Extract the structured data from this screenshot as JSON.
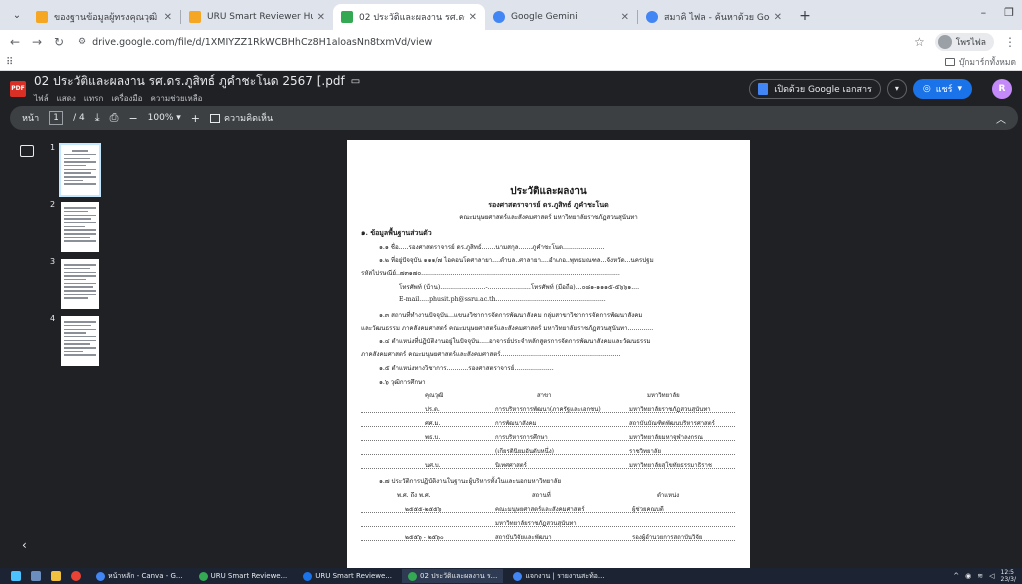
{
  "browser": {
    "tabs": [
      {
        "title": "ของฐานข้อมูลผู้ทรงคุณวุฒิ รายงาน",
        "color": "#f5a623",
        "active": false
      },
      {
        "title": "URU Smart Reviewer Hub",
        "color": "#f5a623",
        "active": false
      },
      {
        "title": "02 ประวัติและผลงาน รศ.ดร.ภูสิทธ์ ภู...",
        "color": "#34a853",
        "active": true
      },
      {
        "title": "Google Gemini",
        "color": "#4285f4",
        "active": false
      },
      {
        "title": "สมาคิ ไฟล - ค้นหาด้วย Google",
        "color": "#4285f4",
        "active": false
      }
    ],
    "url": "drive.google.com/file/d/1XMIYZZ1RkWCBHhCz8H1aloasNn8txmVd/view",
    "profile_label": "โพรไฟล",
    "bookmarks_all": "บุ๊กมาร์กทั้งหมด"
  },
  "viewer": {
    "file_title": "02 ประวัติและผลงาน รศ.ดร.ภูสิทธ์ ภูคำชะโนด 2567 [.pdf",
    "menus": [
      "ไฟล์",
      "แสดง",
      "แทรก",
      "เครื่องมือ",
      "ความช่วยเหลือ"
    ],
    "open_with": "เปิดด้วย Google เอกสาร",
    "share": "แชร์",
    "user_initial": "R",
    "page_label": "หน้า",
    "page_current": "1",
    "page_total": "/ 4",
    "zoom": "100%",
    "comment_label": "ความคิดเห็น",
    "thumbnail_numbers": [
      "1",
      "2",
      "3",
      "4"
    ]
  },
  "document": {
    "title": "ประวัติและผลงาน",
    "name": "รองศาสตราจารย์ ดร.ภูสิทธ์ ภูคำชะโนด",
    "faculty": "คณะมนุษยศาสตร์และสังคมศาสตร์ มหาวิทยาลัยราชภัฏสวนสุนันทา",
    "section1": "๑. ข้อมูลพื้นฐานส่วนตัว",
    "lines": [
      "๑.๑ ชื่อ.....รองศาสตราจารย์ ดร.ภูสิทธ์.......นามสกุล.......ภูคำชะโนด.....................",
      "๑.๒ ที่อยู่ปัจจุบัน ๑๑๑/๗ ไอคอนโดศาลายา....ตำบล..ศาลายา....อำเภอ..พุทธมณฑล...จังหวัด...นครปฐม",
      "รหัสไปรษณีย์..๗๓๑๗๐.....................................................................................................",
      "โทรศัพท์ (บ้าน).......................-......................โทรศัพท์ (มือถือ)...๐๘๑-๑๑๑๕-๕๖๖๑....",
      "E-mail.....phusit.ph@ssru.ac.th........................................................",
      "๑.๓ สถานที่ทำงานปัจจุบัน...แขนงวิชาการจัดการพัฒนาสังคม กลุ่มสาขาวิชาการจัดการพัฒนาสังคม",
      "และวัฒนธรรม ภาคสังคมศาสตร์ คณะมนุษยศาสตร์และสังคมศาสตร์ มหาวิทยาลัยราชภัฏสวนสุนันทา.............",
      "๑.๔ ตำแหน่งที่ปฏิบัติงานอยู่ในปัจจุบัน.....อาจารย์ประจำหลักสูตรการจัดการพัฒนาสังคมและวัฒนธรรม",
      "ภาคสังคมศาสตร์ คณะมนุษยศาสตร์และสังคมศาสตร์.............................................................",
      "๑.๕ ตำแหน่งทางวิชาการ...........รองศาสตราจารย์....................",
      "๑.๖ วุฒิการศึกษา"
    ],
    "edu_header": [
      "คุณวุฒิ",
      "สาขา",
      "มหาวิทยาลัย"
    ],
    "edu_rows": [
      [
        "ปร.ด.",
        "การบริหารการพัฒนา(ภาครัฐและเอกชน)",
        "มหาวิทยาลัยราชภัฏสวนสุนันทา"
      ],
      [
        "ศศ.ม.",
        "การพัฒนาสังคม",
        "สถาบันบัณฑิตพัฒนบริหารศาสตร์"
      ],
      [
        "พธ.บ.",
        "การบริหารการศึกษา",
        "มหาวิทยาลัยมหาจุฬาลงกรณ"
      ],
      [
        "",
        "(เกียรตินิยมอันดับหนึ่ง)",
        "ราชวิทยาลัย"
      ],
      [
        "นศ.บ.",
        "นิเทศศาสตร์",
        "มหาวิทยาลัยสุโขทัยธรรมาธิราช"
      ]
    ],
    "work_title": "๑.๗ ประวัติการปฏิบัติงานในฐานะผู้บริหารทั้งในและนอกมหาวิทยาลัย",
    "work_header": [
      "พ.ศ. ถึง พ.ศ.",
      "สถานที่",
      "ตำแหน่ง"
    ],
    "work_rows": [
      [
        "๒๕๕๕-๒๕๕๖",
        "คณะมนุษยศาสตร์และสังคมศาสตร์",
        "ผู้ช่วยคณบดี"
      ],
      [
        "",
        "มหาวิทยาลัยราชภัฏสวนสุนันทา",
        ""
      ],
      [
        "๒๕๕๖ - ๒๕๖๐",
        "สถาบันวิจัยและพัฒนา",
        "รองผู้อำนวยการสถาบันวิจัย"
      ]
    ]
  },
  "taskbar": {
    "tasks": [
      {
        "label": "หน้าหลัก - Canva - G...",
        "color": "#4285f4",
        "active": false
      },
      {
        "label": "URU Smart Reviewe...",
        "color": "#34a853",
        "active": false
      },
      {
        "label": "URU Smart Reviewe...",
        "color": "#1a73e8",
        "active": false
      },
      {
        "label": "02 ประวัติและผลงาน ร...",
        "color": "#34a853",
        "active": true
      },
      {
        "label": "แจกงาน | รายงานสะท้อ...",
        "color": "#4285f4",
        "active": false
      }
    ],
    "time": "12:5",
    "date": "23/3/"
  }
}
